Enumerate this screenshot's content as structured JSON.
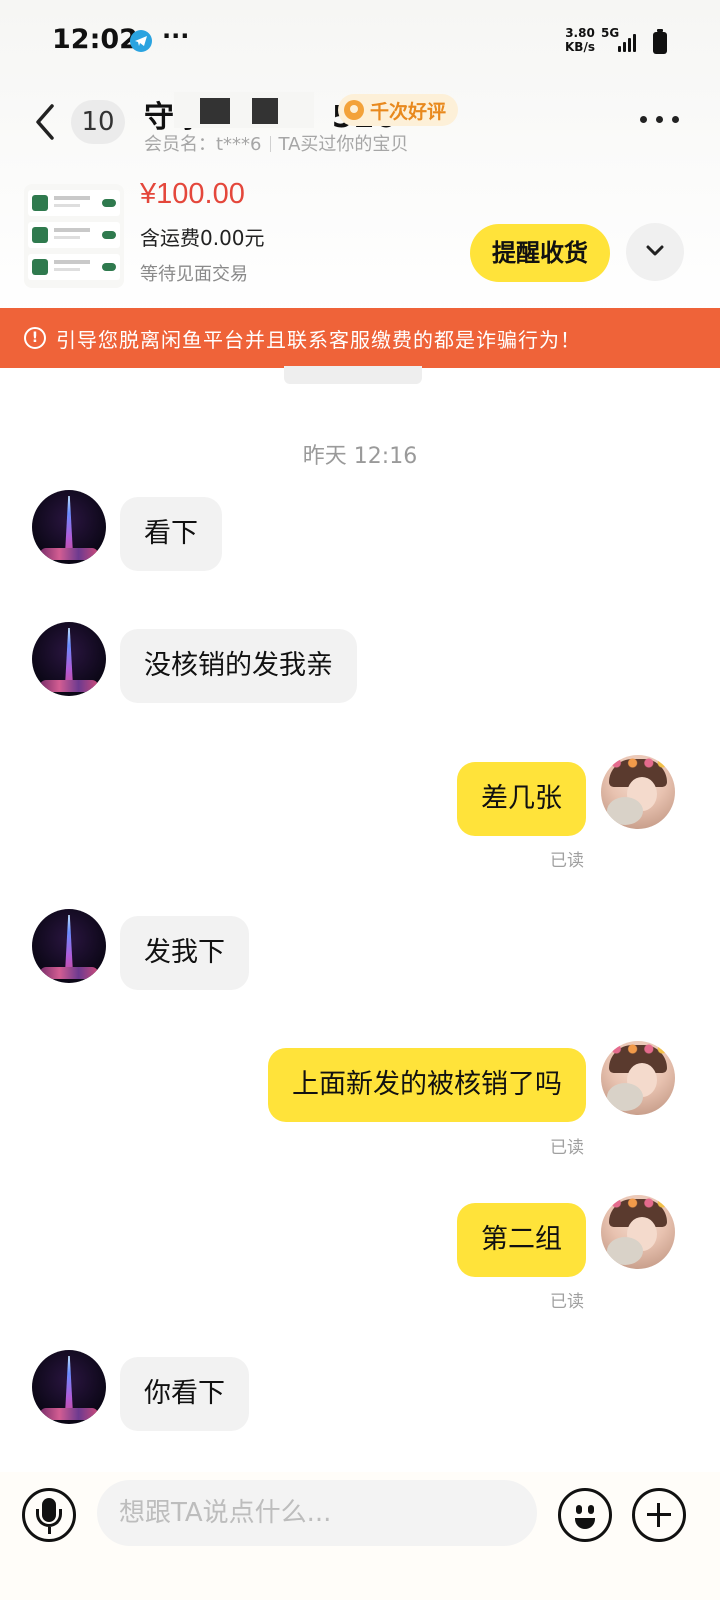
{
  "status_bar": {
    "time": "12:02",
    "more": "···",
    "net_speed_value": "3.80",
    "net_speed_unit": "KB/s",
    "network_type": "5G"
  },
  "header": {
    "unread_count": "10",
    "contact_name": "守水           520",
    "praise_badge": "千次好评",
    "member_label": "会员名：t***6",
    "relation": "TA买过你的宝贝"
  },
  "product": {
    "price": "¥100.00",
    "shipping": "含运费0.00元",
    "status": "等待见面交易",
    "remind_button": "提醒收货"
  },
  "warning": {
    "icon_glyph": "!",
    "text": "引导您脱离闲鱼平台并且联系客服缴费的都是诈骗行为！"
  },
  "chat": {
    "timestamp": "昨天 12:16",
    "messages": [
      {
        "from": "them",
        "text": "看下"
      },
      {
        "from": "them",
        "text": "没核销的发我亲"
      },
      {
        "from": "me",
        "text": "差几张",
        "read": "已读"
      },
      {
        "from": "them",
        "text": "发我下"
      },
      {
        "from": "me",
        "text": "上面新发的被核销了吗",
        "read": "已读"
      },
      {
        "from": "me",
        "text": "第二组",
        "read": "已读"
      },
      {
        "from": "them",
        "text": "你看下"
      }
    ]
  },
  "input_bar": {
    "placeholder": "想跟TA说点什么..."
  },
  "icons": {
    "back": "chevron-left-icon",
    "more": "more-horizontal-icon",
    "expand": "chevron-down-icon",
    "voice": "microphone-icon",
    "emoji": "emoji-icon",
    "add": "plus-circle-icon"
  },
  "colors": {
    "accent_yellow": "#ffe33a",
    "price_red": "#e4473b",
    "warning_orange": "#ef6339",
    "praise_orange": "#e8891e"
  }
}
